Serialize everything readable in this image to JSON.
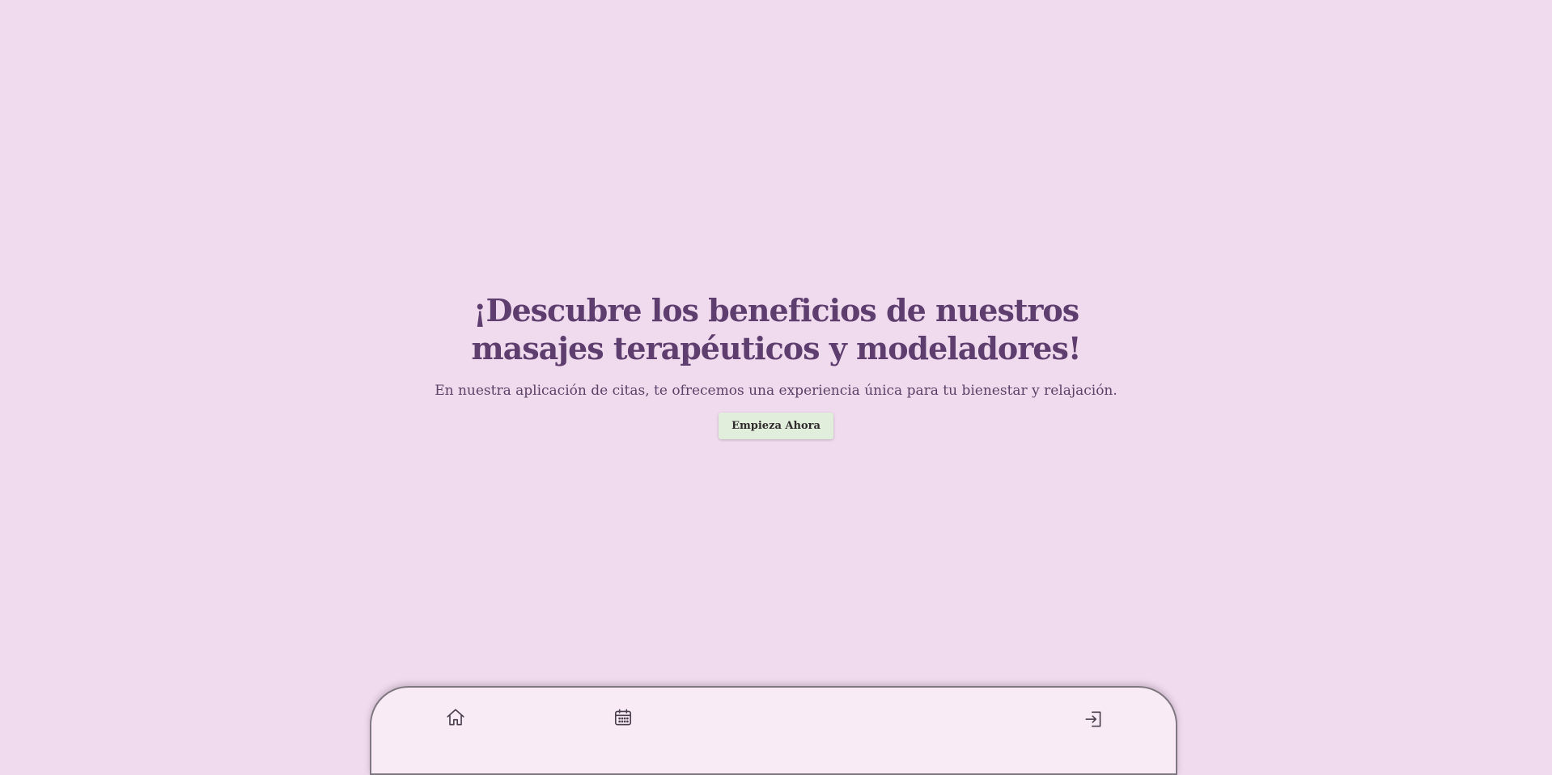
{
  "hero": {
    "title": "¡Descubre los beneficios de nuestros masajes terapéuticos y modeladores!",
    "subtitle": "En nuestra aplicación de citas, te ofrecemos una experiencia única para tu bienestar y relajación.",
    "cta_label": "Empieza Ahora"
  },
  "nav": {
    "items": [
      {
        "icon": "home-icon"
      },
      {
        "icon": "calendar-icon"
      },
      {
        "icon": "login-icon"
      }
    ]
  },
  "colors": {
    "background": "#f0dbee",
    "title": "#5e3e6e",
    "subtitle": "#5c4266",
    "cta_background": "#e1eedc",
    "nav_background": "#f9ebf6"
  }
}
